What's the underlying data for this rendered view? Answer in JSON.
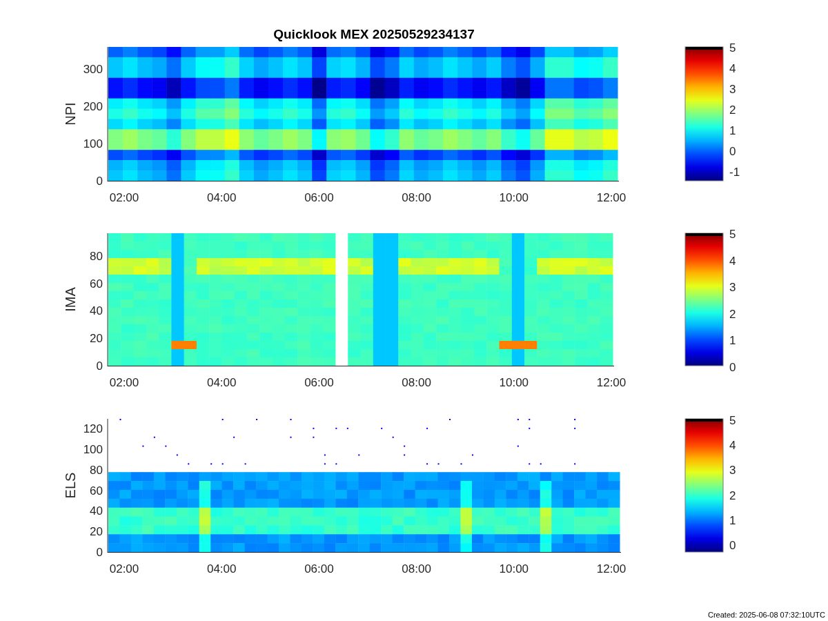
{
  "title": "Quicklook MEX 20250529234137",
  "panels": [
    {
      "kind": "npi",
      "ylabel": "NPI",
      "yticks": [
        "300",
        "200",
        "100",
        "0"
      ],
      "xticks": [
        "02:00",
        "04:00",
        "06:00",
        "08:00",
        "10:00",
        "12:00"
      ],
      "colorbar_ticks": [
        "5",
        "4",
        "3",
        "2",
        "1",
        "0",
        "-1"
      ]
    },
    {
      "kind": "ima",
      "ylabel": "IMA",
      "yticks": [
        "80",
        "60",
        "40",
        "20",
        "0"
      ],
      "xticks": [
        "02:00",
        "04:00",
        "06:00",
        "08:00",
        "10:00",
        "12:00"
      ],
      "colorbar_ticks": [
        "5",
        "4",
        "3",
        "2",
        "1",
        "0"
      ]
    },
    {
      "kind": "els",
      "ylabel": "ELS",
      "yticks": [
        "120",
        "100",
        "80",
        "60",
        "40",
        "20",
        "0"
      ],
      "xticks": [
        "02:00",
        "04:00",
        "06:00",
        "08:00",
        "10:00",
        "12:00"
      ],
      "colorbar_ticks": [
        "5",
        "4",
        "3",
        "2",
        "1",
        "0"
      ]
    }
  ],
  "footer": "Created: 2025-06-08 07:32:10UTC"
}
